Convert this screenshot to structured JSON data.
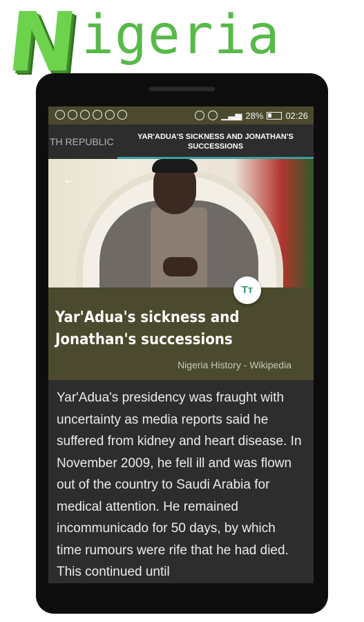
{
  "banner": {
    "first_letter": "N",
    "rest": "igeria"
  },
  "status_bar": {
    "battery": "28%",
    "time": "02:26"
  },
  "tabs": [
    {
      "label": "TH REPUBLIC"
    },
    {
      "label": "YAR'ADUA'S SICKNESS AND JONATHAN'S SUCCESSIONS"
    }
  ],
  "header": {
    "back_icon": "arrow-left-icon",
    "text_size_button": "Tт"
  },
  "article": {
    "title": "Yar'Adua's sickness and Jonathan's successions",
    "source": "Nigeria History - Wikipedia",
    "body": "Yar'Adua's presidency was fraught with uncertainty as media reports said he suffered from kidney and heart disease. In November 2009, he fell ill and was flown out of the country to Saudi Arabia for medical attention. He remained incommunicado for 50 days, by which time rumours were rife that he had died. This continued until"
  },
  "colors": {
    "header_bg": "#4b4a2e",
    "screen_bg": "#2d2d2d",
    "tab_indicator": "#3aa0a0",
    "banner_green": "#58b94a"
  }
}
